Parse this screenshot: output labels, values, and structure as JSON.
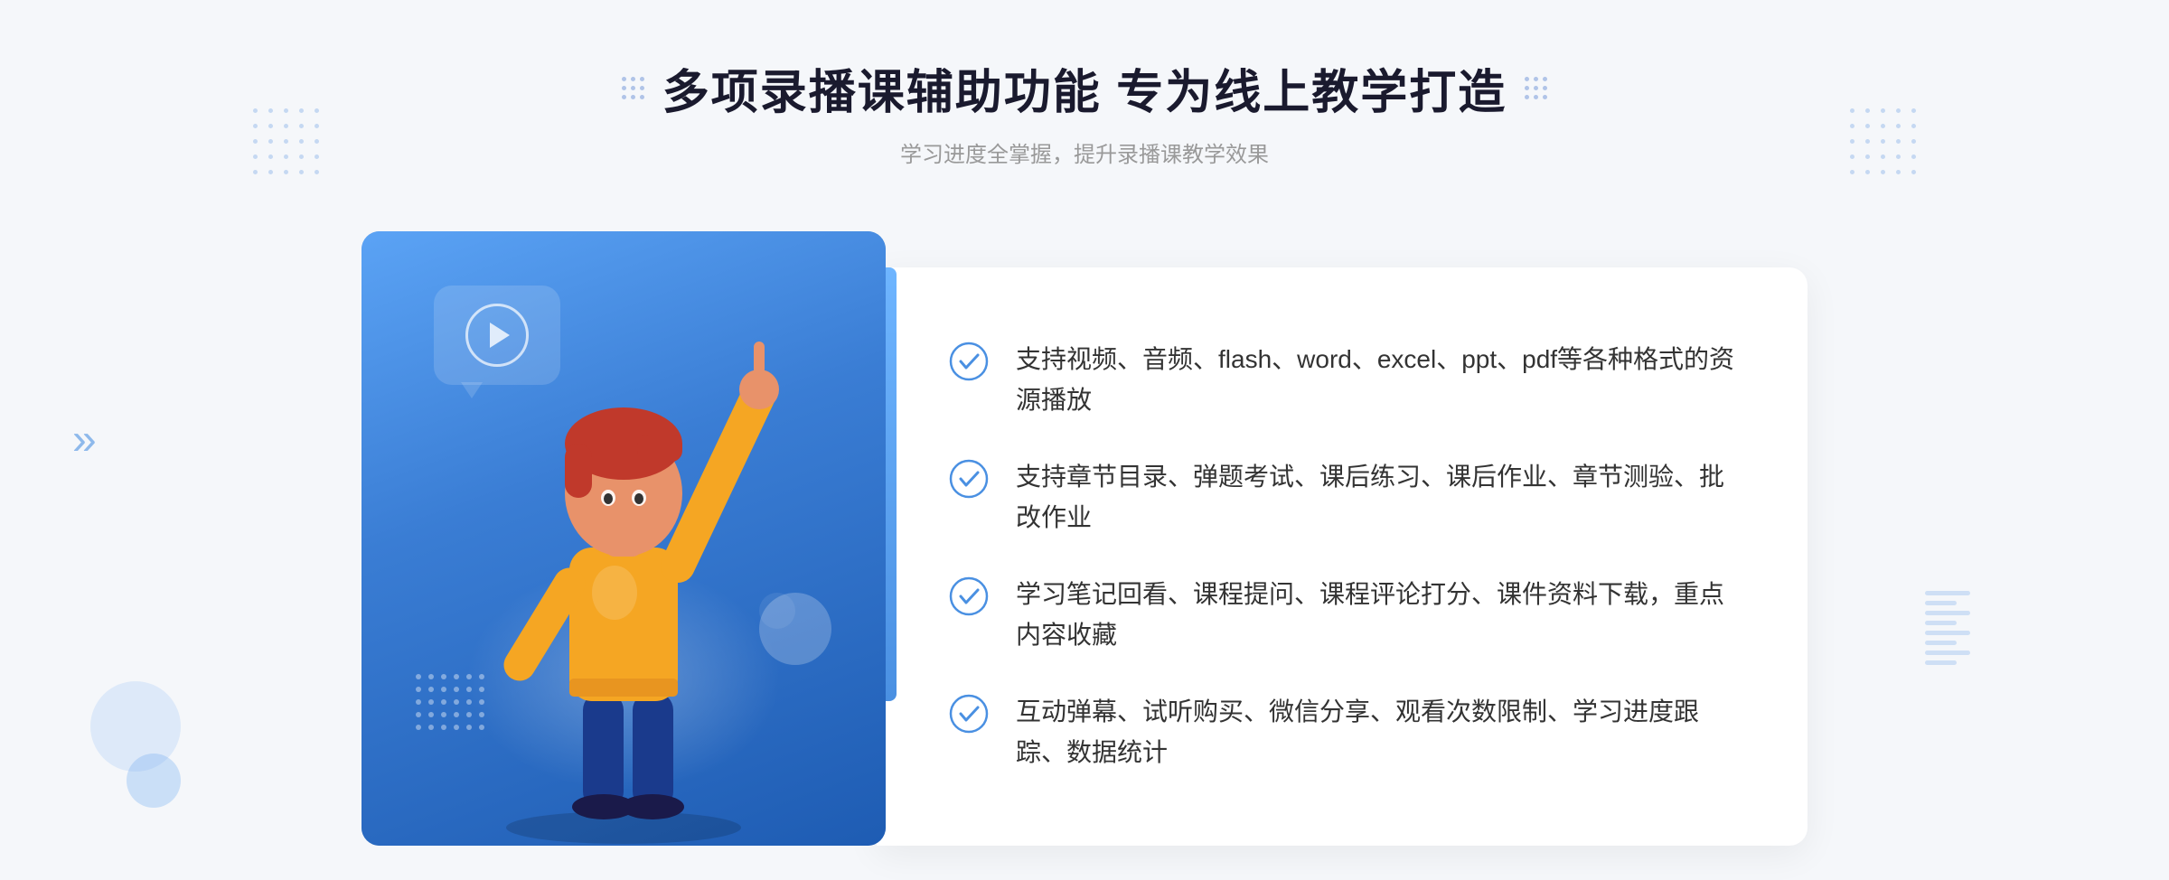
{
  "header": {
    "title": "多项录播课辅助功能 专为线上教学打造",
    "subtitle": "学习进度全掌握，提升录播课教学效果",
    "decoration_dots_left": "::before",
    "decoration_dots_right": "::after"
  },
  "features": [
    {
      "id": 1,
      "text": "支持视频、音频、flash、word、excel、ppt、pdf等各种格式的资源播放"
    },
    {
      "id": 2,
      "text": "支持章节目录、弹题考试、课后练习、课后作业、章节测验、批改作业"
    },
    {
      "id": 3,
      "text": "学习笔记回看、课程提问、课程评论打分、课件资料下载，重点内容收藏"
    },
    {
      "id": 4,
      "text": "互动弹幕、试听购买、微信分享、观看次数限制、学习进度跟踪、数据统计"
    }
  ],
  "colors": {
    "primary_blue": "#4a90e2",
    "dark_blue": "#1e5cb3",
    "light_bg": "#f5f7fa",
    "text_dark": "#1a1a2e",
    "text_gray": "#999"
  }
}
